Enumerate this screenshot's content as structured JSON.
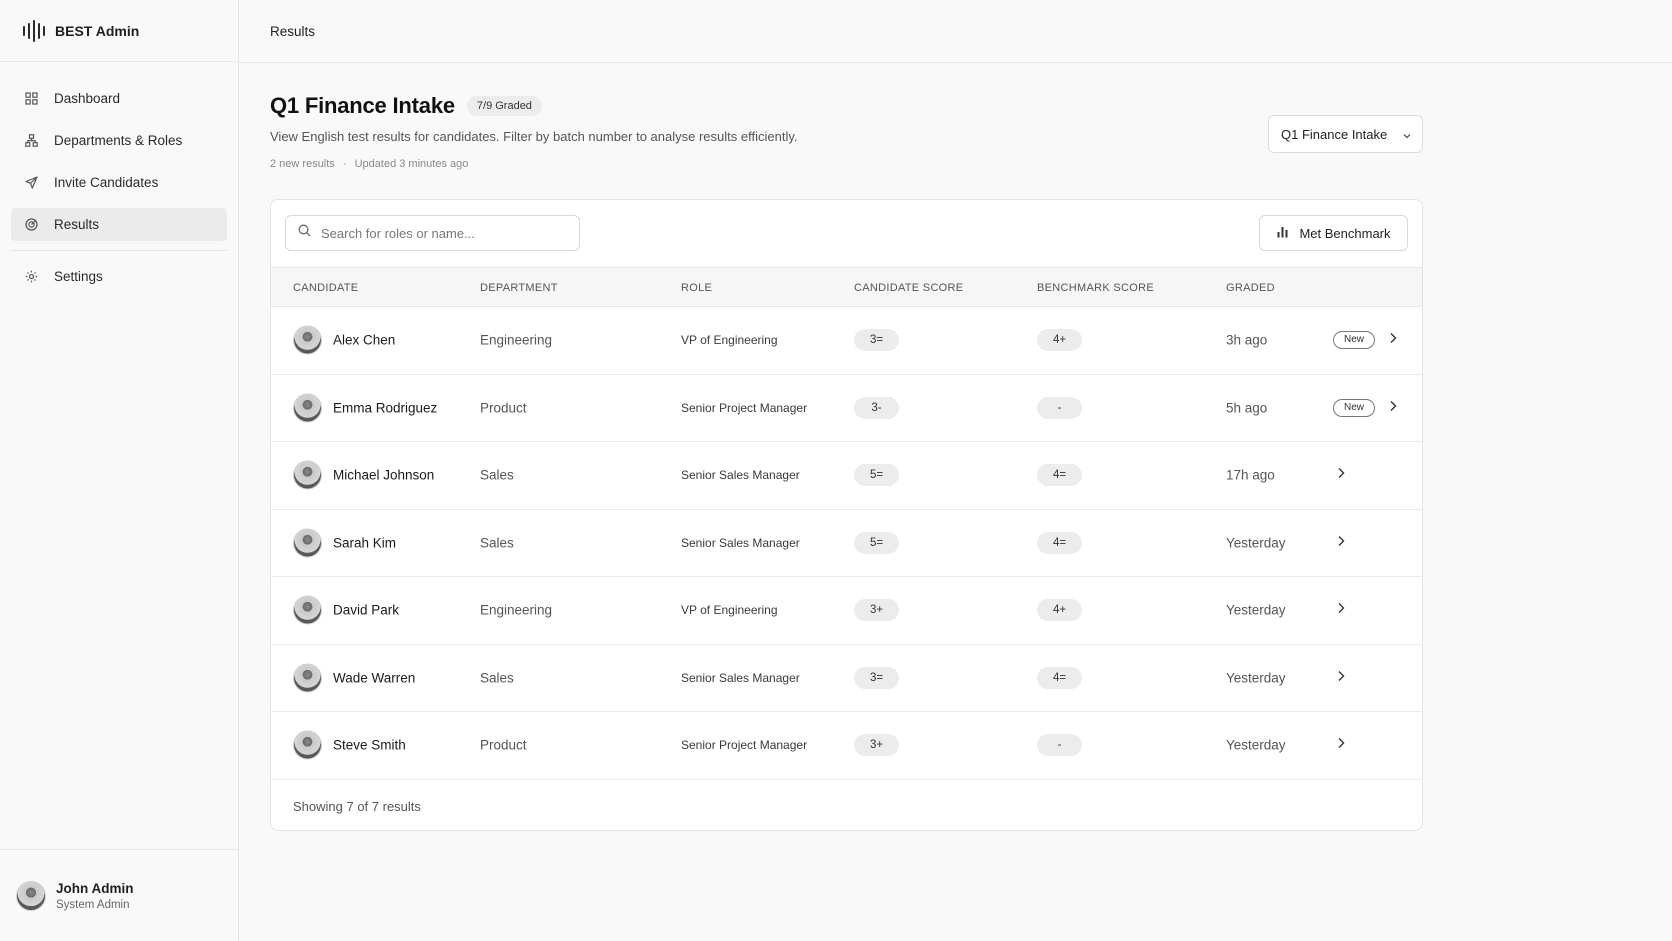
{
  "app": {
    "title": "BEST Admin"
  },
  "sidebar": {
    "items": [
      {
        "label": "Dashboard",
        "icon": "grid-icon"
      },
      {
        "label": "Departments & Roles",
        "icon": "org-chart-icon"
      },
      {
        "label": "Invite Candidates",
        "icon": "send-icon"
      },
      {
        "label": "Results",
        "icon": "target-icon",
        "active": true
      },
      {
        "label": "Settings",
        "icon": "gear-icon"
      }
    ],
    "user": {
      "name": "John Admin",
      "role": "System Admin"
    }
  },
  "header": {
    "breadcrumb": "Results"
  },
  "page": {
    "title": "Q1 Finance Intake",
    "graded_badge": "7/9 Graded",
    "subtitle": "View English test results for candidates. Filter by batch number to analyse results efficiently.",
    "new_results": "2 new results",
    "separator": "·",
    "updated": "Updated 3 minutes ago",
    "batch_select": "Q1 Finance Intake"
  },
  "search": {
    "placeholder": "Search for roles or name..."
  },
  "toolbar": {
    "benchmark_label": "Met Benchmark"
  },
  "table": {
    "headers": {
      "candidate": "CANDIDATE",
      "department": "DEPARTMENT",
      "role": "ROLE",
      "candidate_score": "CANDIDATE SCORE",
      "benchmark_score": "BENCHMARK SCORE",
      "graded": "GRADED"
    },
    "rows": [
      {
        "name": "Alex Chen",
        "department": "Engineering",
        "role": "VP of Engineering",
        "candidate_score": "3=",
        "benchmark_score": "4+",
        "graded": "3h ago",
        "badge": "New"
      },
      {
        "name": "Emma Rodriguez",
        "department": "Product",
        "role": "Senior Project Manager",
        "candidate_score": "3-",
        "benchmark_score": "-",
        "graded": "5h ago",
        "badge": "New"
      },
      {
        "name": "Michael Johnson",
        "department": "Sales",
        "role": "Senior Sales Manager",
        "candidate_score": "5=",
        "benchmark_score": "4=",
        "graded": "17h ago",
        "badge": ""
      },
      {
        "name": "Sarah Kim",
        "department": "Sales",
        "role": "Senior Sales Manager",
        "candidate_score": "5=",
        "benchmark_score": "4=",
        "graded": "Yesterday",
        "badge": ""
      },
      {
        "name": "David Park",
        "department": "Engineering",
        "role": "VP of Engineering",
        "candidate_score": "3+",
        "benchmark_score": "4+",
        "graded": "Yesterday",
        "badge": ""
      },
      {
        "name": "Wade Warren",
        "department": "Sales",
        "role": "Senior Sales Manager",
        "candidate_score": "3=",
        "benchmark_score": "4=",
        "graded": "Yesterday",
        "badge": ""
      },
      {
        "name": "Steve Smith",
        "department": "Product",
        "role": "Senior Project Manager",
        "candidate_score": "3+",
        "benchmark_score": "-",
        "graded": "Yesterday",
        "badge": ""
      }
    ],
    "footer": "Showing 7 of 7 results"
  }
}
